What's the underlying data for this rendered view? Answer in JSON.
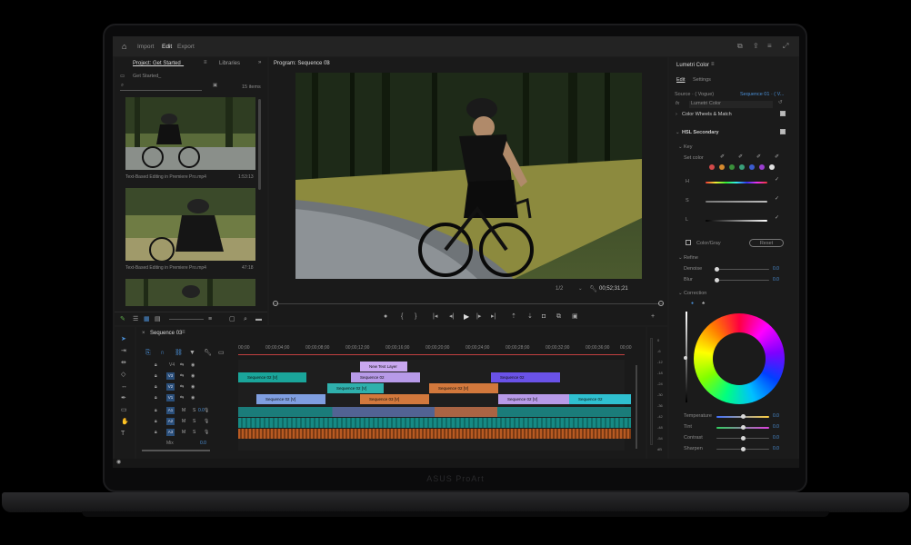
{
  "topbar": {
    "import": "Import",
    "edit": "Edit",
    "export": "Export"
  },
  "project": {
    "tab": "Project: Get Started_",
    "libraries": "Libraries",
    "path": "Get Started_",
    "items": "15 items",
    "clips": [
      {
        "name": "Text-Based Editing in Premiere Pro.mp4",
        "duration": "1:53:13"
      },
      {
        "name": "Text-Based Editing in Premiere Pro.mp4",
        "duration": "47:18"
      }
    ]
  },
  "program": {
    "title": "Program: Sequence 03",
    "fraction": "1/2",
    "timecode": "00;52;31;21"
  },
  "sequence": {
    "tab": "Sequence 03",
    "ruler": [
      "00;00",
      "00;00;04;00",
      "00;00;08;00",
      "00;00;12;00",
      "00;00;16;00",
      "00;00;20;00",
      "00;00;24;00",
      "00;00;28;00",
      "00;00;32;00",
      "00;00;36;00",
      "00;00"
    ],
    "tracks_video": [
      "V4",
      "V3",
      "V2",
      "V1"
    ],
    "tracks_audio": [
      "A1",
      "A2",
      "A3"
    ],
    "mix": "Mix",
    "mix_val": "0.0",
    "audio_val": "0.0",
    "clips": {
      "text": "New Text Layer",
      "seq02": "Sequence 02",
      "seq02v": "Sequence 02 [V]",
      "seq03v": "Sequence 03 [V]"
    }
  },
  "meter": [
    "0",
    "-6",
    "-12",
    "-18",
    "-24",
    "-30",
    "-36",
    "-42",
    "-48",
    "-54",
    "dB"
  ],
  "lumetri": {
    "title": "Lumetri Color",
    "tab_edit": "Edit",
    "tab_settings": "Settings",
    "source": "Source · ( Vogue)",
    "seq": "Sequence 01 · ( V...",
    "fx": "fx",
    "effect": "Lumetri Color",
    "wheels": "Color Wheels & Match",
    "hsl": "HSL Secondary",
    "key": "Key",
    "set_color": "Set color",
    "h": "H",
    "s": "S",
    "l": "L",
    "color_gray": "Color/Gray",
    "reset": "Reset",
    "refine": "Refine",
    "denoise": "Denoise",
    "blur": "Blur",
    "denoise_val": "0.0",
    "blur_val": "0.0",
    "correction": "Correction",
    "sliders": [
      {
        "label": "Temperature",
        "value": "0.0"
      },
      {
        "label": "Tint",
        "value": "0.0"
      },
      {
        "label": "Contrast",
        "value": "0.0"
      },
      {
        "label": "Sharpen",
        "value": "0.0"
      }
    ],
    "swatches": [
      "#d24a4a",
      "#d58a2e",
      "#3a8f3a",
      "#3a9f7a",
      "#3b5ccf",
      "#9a3fcf",
      "#e0e0e0"
    ]
  },
  "laptop": {
    "brand": "ASUS ProArt"
  }
}
